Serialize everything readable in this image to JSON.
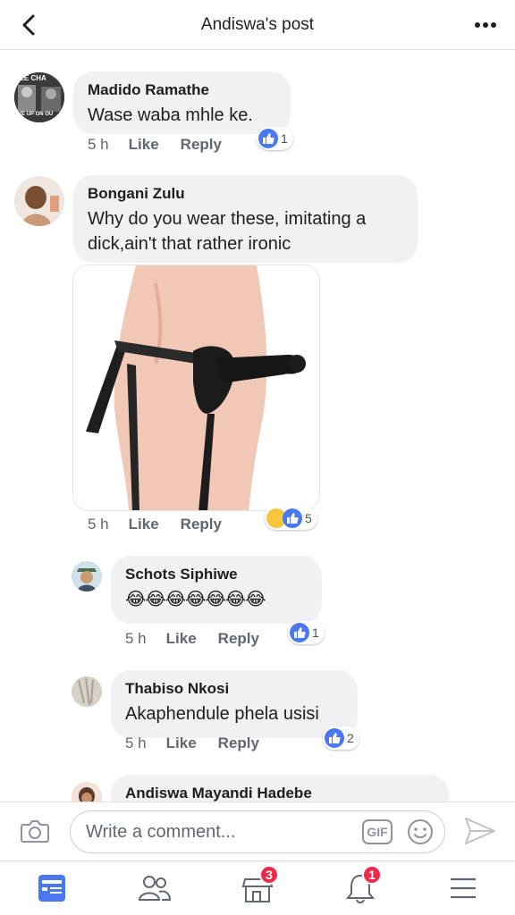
{
  "header": {
    "title": "Andiswa's post"
  },
  "comments": [
    {
      "name": "Madido Ramathe",
      "text": "Wase  waba mhle ke.",
      "time": "5 h",
      "like": "Like",
      "reply": "Reply",
      "reactions": "1",
      "avatar_text_top": "LE CHA",
      "avatar_text_bottom": "VE UP ON OU"
    },
    {
      "name": "Bongani Zulu",
      "text": "Why do you wear these, imitating a dick,ain't that rather ironic",
      "time": "5 h",
      "like": "Like",
      "reply": "Reply",
      "reactions": "5"
    }
  ],
  "replies": [
    {
      "name": "Schots Siphiwe",
      "text": "😂😂😂😂😂😂😂",
      "time": "5 h",
      "like": "Like",
      "reply": "Reply",
      "reactions": "1"
    },
    {
      "name": "Thabiso Nkosi",
      "text": "Akaphendule phela usisi",
      "time": "5 h",
      "like": "Like",
      "reply": "Reply",
      "reactions": "2"
    },
    {
      "name": "Andiswa Mayandi Hadebe"
    }
  ],
  "composer": {
    "placeholder": "Write a comment...",
    "gif_label": "GIF"
  },
  "tabbar": {
    "marketplace_badge": "3",
    "notifications_badge": "1"
  },
  "colors": {
    "accent": "#4a78f0",
    "bubble": "#f0f1f3",
    "badge": "#f02849"
  },
  "icons": [
    "back-icon",
    "more-icon",
    "camera-icon",
    "gif-icon",
    "emoji-icon",
    "send-icon",
    "news-feed-icon",
    "friends-icon",
    "marketplace-icon",
    "notifications-icon",
    "menu-icon",
    "like-icon",
    "haha-icon"
  ]
}
